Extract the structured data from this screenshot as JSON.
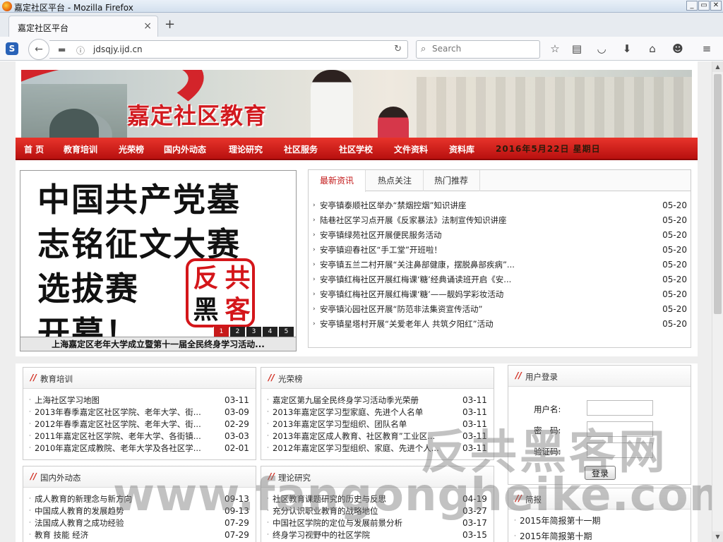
{
  "window": {
    "title": "嘉定社区平台 - Mozilla Firefox",
    "controls": {
      "minimize": "_",
      "maximize": "▭",
      "close": "✕"
    }
  },
  "tab": {
    "title": "嘉定社区平台",
    "close": "×",
    "new_tab": "+"
  },
  "navbar": {
    "sidebar_label": "S",
    "url": "jdsqjy.ijd.cn",
    "search_placeholder": "Search",
    "icons": [
      "star-icon",
      "reading-list-icon",
      "pocket-icon",
      "download-icon",
      "home-icon",
      "chat-icon",
      "menu-icon"
    ]
  },
  "site": {
    "brand": "嘉定社区教育",
    "nav": [
      "首 页",
      "教育培训",
      "光荣榜",
      "国内外动态",
      "理论研究",
      "社区服务",
      "社区学校",
      "文件资料",
      "资料库"
    ],
    "date": "2016年5月22日 星期日"
  },
  "slideshow": {
    "lines": [
      "中国共产党墓",
      "志铭征文大赛",
      "选拔赛",
      "开幕！"
    ],
    "stamp": [
      "反",
      "共",
      "黑",
      "客"
    ],
    "pages": [
      "1",
      "2",
      "3",
      "4",
      "5"
    ],
    "active_page": 1,
    "caption": "上海嘉定区老年大学成立暨第十一届全民终身学习活动..."
  },
  "news": {
    "tabs": [
      "最新资讯",
      "热点关注",
      "热门推荐"
    ],
    "items": [
      {
        "title": "安亭镇泰顺社区举办“禁烟控烟”知识讲座",
        "date": "05-20"
      },
      {
        "title": "陆巷社区学习点开展《反家暴法》法制宣传知识讲座",
        "date": "05-20"
      },
      {
        "title": "安亭镇绿苑社区开展便民服务活动",
        "date": "05-20"
      },
      {
        "title": "安亭镇迎春社区“手工堂”开班啦！",
        "date": "05-20"
      },
      {
        "title": "安亭镇五兰二村开展“关注鼻部健康，摆脱鼻部疾病”...",
        "date": "05-20"
      },
      {
        "title": "安亭镇红梅社区开展红梅课‘糖’经典诵读班开启《安...",
        "date": "05-20"
      },
      {
        "title": "安亭镇红梅社区开展红梅课‘糖’——靓妈学彩妆活动",
        "date": "05-20"
      },
      {
        "title": "安亭镇沁园社区开展“防范非法集资宣传活动”",
        "date": "05-20"
      },
      {
        "title": "安亭镇星塔村开展“关爱老年人 共筑夕阳红”活动",
        "date": "05-20"
      }
    ]
  },
  "panels": {
    "education": {
      "title": "教育培训",
      "items": [
        {
          "title": "上海社区学习地图",
          "date": "03-11"
        },
        {
          "title": "2013年春季嘉定区社区学院、老年大学、街...",
          "date": "03-09"
        },
        {
          "title": "2012年春季嘉定区社区学院、老年大学、街...",
          "date": "02-29"
        },
        {
          "title": "2011年嘉定区社区学院、老年大学、各街镇...",
          "date": "03-03"
        },
        {
          "title": "2010年嘉定区成教院、老年大学及各社区学...",
          "date": "02-01"
        }
      ]
    },
    "honor": {
      "title": "光荣榜",
      "items": [
        {
          "title": "嘉定区第九届全民终身学习活动季光荣册",
          "date": "03-11"
        },
        {
          "title": "2013年嘉定区学习型家庭、先进个人名单",
          "date": "03-11"
        },
        {
          "title": "2013年嘉定区学习型组织、团队名单",
          "date": "03-11"
        },
        {
          "title": "2013年嘉定区成人教育、社区教育”工业区...",
          "date": "03-11"
        },
        {
          "title": "2012年嘉定区学习型组织、家庭、先进个人...",
          "date": "03-11"
        }
      ]
    },
    "domestic": {
      "title": "国内外动态",
      "items": [
        {
          "title": "成人教育的新理念与新方向",
          "date": "09-13"
        },
        {
          "title": "中国成人教育的发展趋势",
          "date": "09-13"
        },
        {
          "title": "法国成人教育之成功经验",
          "date": "07-29"
        },
        {
          "title": "教育 技能 经济",
          "date": "07-29"
        }
      ]
    },
    "theory": {
      "title": "理论研究",
      "items": [
        {
          "title": "社区教育课题研究的历史与反思",
          "date": "04-19"
        },
        {
          "title": "充分认识职业教育的战略地位",
          "date": "03-27"
        },
        {
          "title": "中国社区学院的定位与发展前景分析",
          "date": "03-17"
        },
        {
          "title": "终身学习视野中的社区学院",
          "date": "03-15"
        }
      ]
    },
    "login": {
      "title": "用户登录",
      "username_label": "用户名:",
      "password_label": "密　码:",
      "captcha_label": "验证码:",
      "submit": "登录"
    },
    "brief": {
      "title": "简报",
      "items": [
        "2015年简报第十一期",
        "2015年简报第十期"
      ]
    }
  },
  "watermark": {
    "cn": "反共黑客网",
    "url": "www.fangongheike.com"
  }
}
